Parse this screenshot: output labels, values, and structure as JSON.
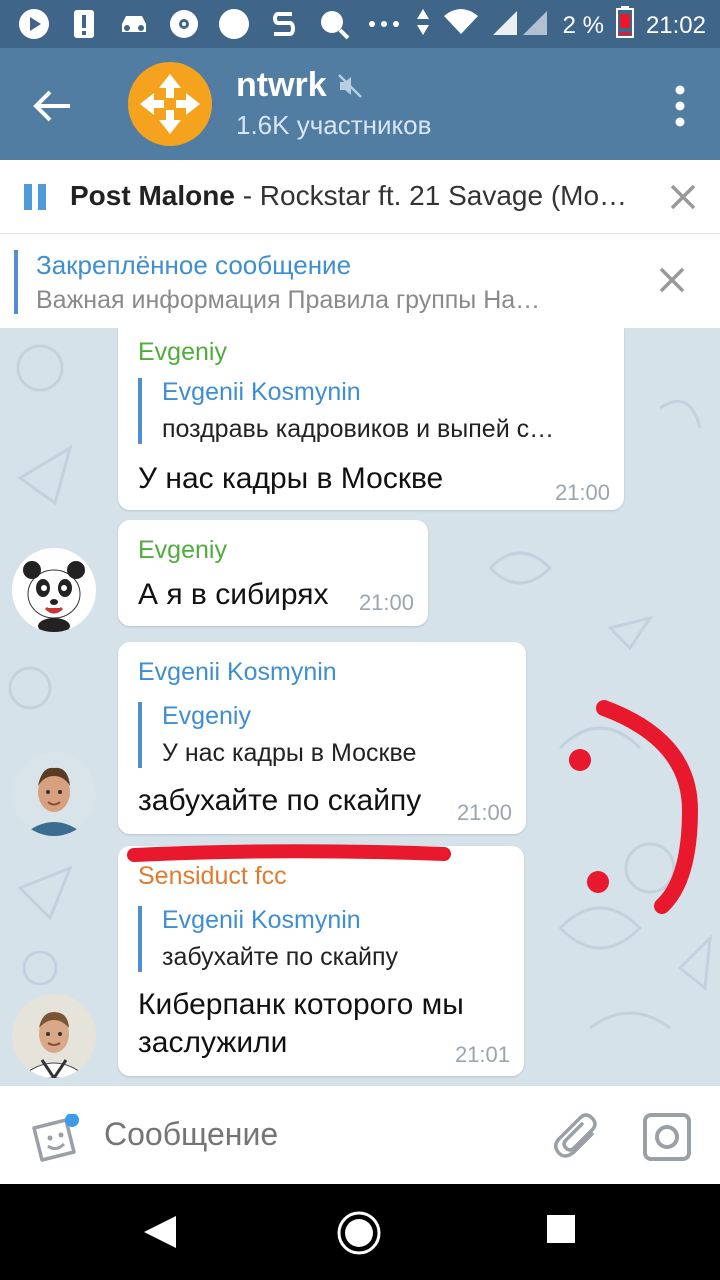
{
  "status_bar": {
    "battery_percent": "2 %",
    "time": "21:02",
    "icons": [
      "play-icon",
      "alert-icon",
      "car-icon",
      "disc-icon",
      "circle-icon",
      "s-app-icon",
      "search-icon",
      "more-icon",
      "data-arrows-icon",
      "wifi-icon",
      "signal-icon",
      "battery-icon"
    ]
  },
  "header": {
    "title": "ntwrk",
    "subtitle": "1.6K участников",
    "muted_icon": "mute-icon"
  },
  "music": {
    "artist": "Post Malone",
    "track": " - Rockstar ft. 21 Savage (Mo…"
  },
  "pinned": {
    "title": "Закреплённое сообщение",
    "text": "Важная информация  Правила группы  На…"
  },
  "messages": [
    {
      "sender": "Evgeniy",
      "sender_color": "#4fad3c",
      "reply_name": "Evgenii Kosmynin",
      "reply_text": "поздравь кадровиков и выпей с…",
      "text": "У нас кадры в Москве",
      "time": "21:00"
    },
    {
      "sender": "Evgeniy",
      "sender_color": "#4fad3c",
      "text": "А я в сибирях",
      "time": "21:00",
      "avatar": "panda-avatar"
    },
    {
      "sender": "Evgenii Kosmynin",
      "sender_color": "#3e8ed0",
      "reply_name": "Evgeniy",
      "reply_text": "У нас кадры в Москве",
      "text": "забухайте по скайпу",
      "time": "21:00",
      "avatar": "man-avatar"
    },
    {
      "sender": "Sensiduct fcc",
      "sender_color": "#e07b2d",
      "reply_name": "Evgenii Kosmynin",
      "reply_text": "забухайте по скайпу",
      "text_line1": "Киберпанк которого мы",
      "text_line2": "заслужили",
      "time": "21:01",
      "avatar": "man2-avatar"
    }
  ],
  "input": {
    "placeholder": "Сообщение"
  },
  "colors": {
    "header": "#527da3",
    "status_bar": "#3f6589",
    "link": "#3e8ed0",
    "annotation": "#e8192c"
  }
}
